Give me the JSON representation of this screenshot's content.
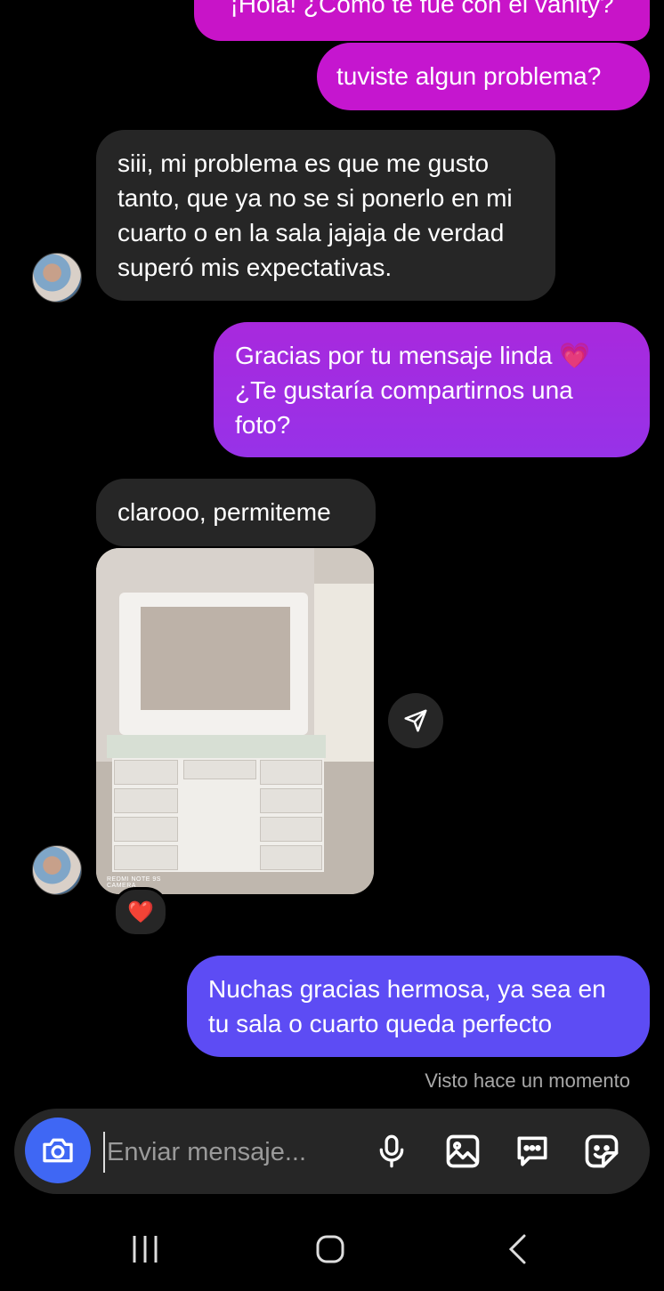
{
  "messages": {
    "m1": "¡Hola! ¿Cómo te fue con el vanity?",
    "m2": "tuviste algun problema?",
    "m3": "siii, mi problema es que me gusto tanto, que ya no se si ponerlo en mi cuarto o en la sala jajaja de verdad superó mis expectativas.",
    "m4_text": "Gracias por tu mensaje linda",
    "m4_emoji": "💗",
    "m4_text2": "¿Te gustaría compartirnos una foto?",
    "m5": "clarooo, permiteme",
    "m6": "Nuchas gracias hermosa, ya sea en tu sala o cuarto queda perfecto"
  },
  "photo": {
    "watermark_line1": "REDMI NOTE 9S",
    "watermark_line2": "CAMERA"
  },
  "reaction": "❤️",
  "seen_status": "Visto hace un momento",
  "composer": {
    "placeholder": "Enviar mensaje..."
  },
  "colors": {
    "outgoing_top": "#c516cf",
    "outgoing_mid": "#9732e8",
    "outgoing_bottom": "#5d4cf4",
    "incoming": "#262626",
    "camera_button": "#3f67f4"
  },
  "icons": [
    "camera-icon",
    "microphone-icon",
    "gallery-icon",
    "chat-bubble-icon",
    "sticker-icon",
    "send-icon",
    "recent-apps-icon",
    "home-icon",
    "back-icon"
  ]
}
